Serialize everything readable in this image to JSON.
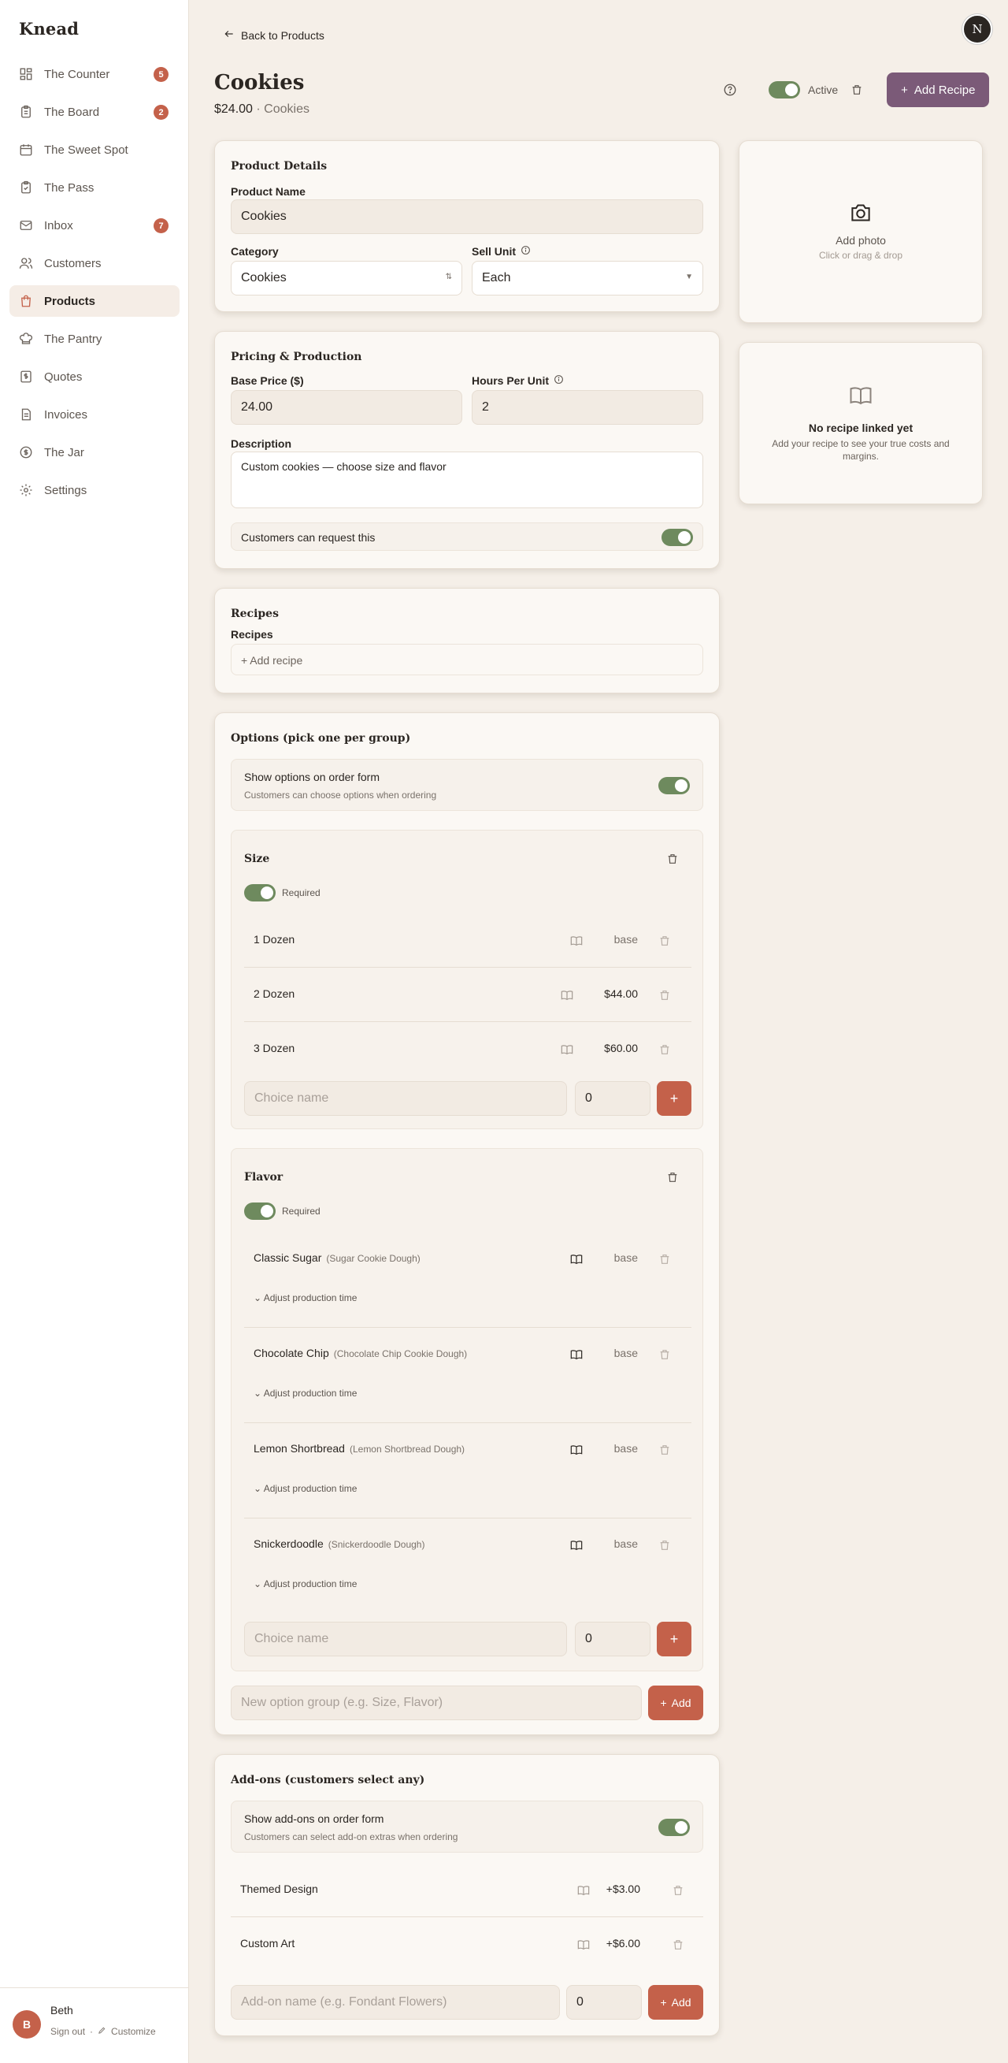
{
  "app": {
    "brand": "Knead"
  },
  "nav": [
    {
      "label": "The Counter",
      "icon": "grid-icon",
      "badge": "5"
    },
    {
      "label": "The Board",
      "icon": "clipboard-icon",
      "badge": "2"
    },
    {
      "label": "The Sweet Spot",
      "icon": "calendar-icon",
      "badge": ""
    },
    {
      "label": "The Pass",
      "icon": "clipboard-check-icon",
      "badge": ""
    },
    {
      "label": "Inbox",
      "icon": "mail-icon",
      "badge": "7"
    },
    {
      "label": "Customers",
      "icon": "users-icon",
      "badge": ""
    },
    {
      "label": "Products",
      "icon": "bag-icon",
      "badge": ""
    },
    {
      "label": "The Pantry",
      "icon": "chef-hat-icon",
      "badge": ""
    },
    {
      "label": "Quotes",
      "icon": "dollar-file-icon",
      "badge": ""
    },
    {
      "label": "Invoices",
      "icon": "file-icon",
      "badge": ""
    },
    {
      "label": "The Jar",
      "icon": "dollar-circle-icon",
      "badge": ""
    },
    {
      "label": "Settings",
      "icon": "gear-icon",
      "badge": ""
    }
  ],
  "user": {
    "initial": "B",
    "name": "Beth",
    "signout": "Sign out",
    "separator": "·",
    "customize": "Customize"
  },
  "header": {
    "back": "Back to Products",
    "avatar": "N",
    "title": "Cookies",
    "price": "$24.00",
    "dot": " · ",
    "category": "Cookies",
    "active_label": "Active",
    "add_recipe": "Add Recipe"
  },
  "details": {
    "title": "Product Details",
    "name_label": "Product Name",
    "name_value": "Cookies",
    "category_label": "Category",
    "category_value": "Cookies",
    "unit_label": "Sell Unit",
    "unit_value": "Each"
  },
  "pricing": {
    "title": "Pricing & Production",
    "price_label": "Base Price ($)",
    "price_value": "24.00",
    "hours_label": "Hours Per Unit",
    "hours_value": "2",
    "desc_label": "Description",
    "desc_value": "Custom cookies — choose size and flavor",
    "request_label": "Customers can request this"
  },
  "recipes": {
    "title": "Recipes",
    "label": "Recipes",
    "add": "Add recipe"
  },
  "photo": {
    "title": "Add photo",
    "hint": "Click or drag & drop"
  },
  "recipe_link": {
    "title": "No recipe linked yet",
    "hint": "Add your recipe to see your true costs and margins."
  },
  "options": {
    "title": "Options (pick one per group)",
    "show_label": "Show options on order form",
    "show_hint": "Customers can choose options when ordering",
    "required": "Required",
    "choice_placeholder": "Choice name",
    "choice_price": "0",
    "size": {
      "title": "Size",
      "rows": [
        {
          "name": "1 Dozen",
          "price": "base"
        },
        {
          "name": "2 Dozen",
          "price": "$44.00"
        },
        {
          "name": "3 Dozen",
          "price": "$60.00"
        }
      ]
    },
    "flavor": {
      "title": "Flavor",
      "adjust": "Adjust production time",
      "rows": [
        {
          "name": "Classic Sugar",
          "recipe": "(Sugar Cookie Dough)",
          "price": "base"
        },
        {
          "name": "Chocolate Chip",
          "recipe": "(Chocolate Chip Cookie Dough)",
          "price": "base"
        },
        {
          "name": "Lemon Shortbread",
          "recipe": "(Lemon Shortbread Dough)",
          "price": "base"
        },
        {
          "name": "Snickerdoodle",
          "recipe": "(Snickerdoodle Dough)",
          "price": "base"
        }
      ]
    },
    "new_group_placeholder": "New option group (e.g. Size, Flavor)",
    "add": "Add"
  },
  "addons": {
    "title": "Add-ons (customers select any)",
    "show_label": "Show add-ons on order form",
    "show_hint": "Customers can select add-on extras when ordering",
    "rows": [
      {
        "name": "Themed Design",
        "price": "+$3.00"
      },
      {
        "name": "Custom Art",
        "price": "+$6.00"
      }
    ],
    "name_placeholder": "Add-on name (e.g. Fondant Flowers)",
    "price_value": "0",
    "add": "Add"
  },
  "colors": {
    "accent": "#c4614a",
    "purple": "#7b5a78",
    "green": "#6e8a5e",
    "bg": "#f5efe8"
  }
}
